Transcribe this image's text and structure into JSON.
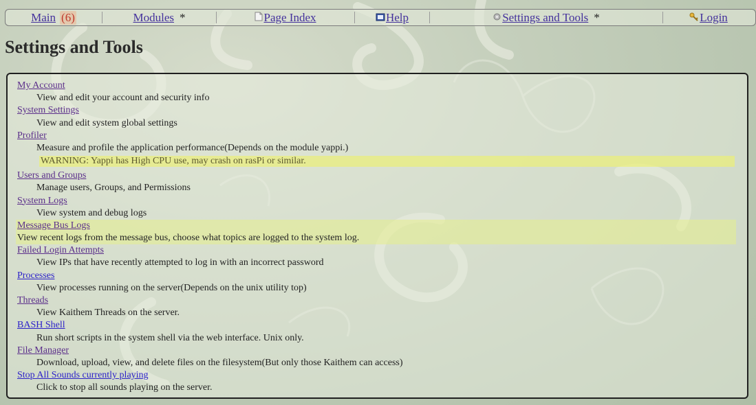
{
  "nav": {
    "main_label": "Main",
    "main_badge": "(6)",
    "modules_label": "Modules",
    "modules_star": "*",
    "page_index_label": "Page Index",
    "help_label": "Help",
    "settings_label": "Settings and Tools",
    "settings_star": "*",
    "login_label": "Login"
  },
  "page": {
    "title": "Settings and Tools"
  },
  "tools": [
    {
      "label": "My Account",
      "desc": "View and edit your account and security info"
    },
    {
      "label": "System Settings",
      "desc": "View and edit system global settings"
    },
    {
      "label": "Profiler",
      "desc": "Measure and profile the application performance(Depends on the module yappi.)",
      "warning": "WARNING: Yappi has High CPU use, may crash on rasPi or similar."
    },
    {
      "label": "Users and Groups",
      "desc": "Manage users, Groups, and Permissions"
    },
    {
      "label": "System Logs",
      "desc": "View system and debug logs"
    },
    {
      "label": "Message Bus Logs",
      "desc": "View recent logs from the message bus, choose what topics are logged to the system log."
    },
    {
      "label": "Failed Login Attempts",
      "desc": "View IPs that have recently attempted to log in with an incorrect password"
    },
    {
      "label": "Processes",
      "desc": "View processes running on the server(Depends on the unix utility top)"
    },
    {
      "label": "Threads",
      "desc": "View Kaithem Threads on the server."
    },
    {
      "label": "BASH Shell",
      "desc": "Run short scripts in the system shell via the web interface. Unix only."
    },
    {
      "label": "File Manager",
      "desc": "Download, upload, view, and delete files on the filesystem(But only those Kaithem can access)"
    },
    {
      "label": "Stop All Sounds currently playing",
      "desc": "Click to stop all sounds playing on the server."
    }
  ],
  "icons": {
    "page_index": "page-icon",
    "help": "book-icon",
    "settings": "gear-icon",
    "login": "key-icon"
  },
  "colors": {
    "link_visited": "#5a2d8a",
    "link_unvisited": "#2a1fc9",
    "warning_bg": "#ebf078",
    "badge": "#c0392b"
  }
}
